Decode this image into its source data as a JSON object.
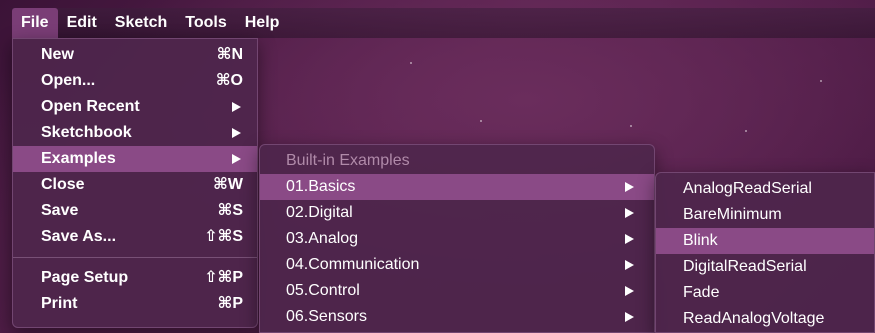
{
  "menubar": {
    "items": [
      {
        "label": "File",
        "active": true
      },
      {
        "label": "Edit"
      },
      {
        "label": "Sketch"
      },
      {
        "label": "Tools"
      },
      {
        "label": "Help"
      }
    ]
  },
  "file_menu": {
    "items": [
      {
        "label": "New",
        "shortcut": "⌘N"
      },
      {
        "label": "Open...",
        "shortcut": "⌘O"
      },
      {
        "label": "Open Recent",
        "submenu": true
      },
      {
        "label": "Sketchbook",
        "submenu": true
      },
      {
        "label": "Examples",
        "submenu": true,
        "highlighted": true
      },
      {
        "label": "Close",
        "shortcut": "⌘W"
      },
      {
        "label": "Save",
        "shortcut": "⌘S"
      },
      {
        "label": "Save As...",
        "shortcut": "⇧⌘S"
      },
      {
        "label": "Page Setup",
        "shortcut": "⇧⌘P"
      },
      {
        "label": "Print",
        "shortcut": "⌘P"
      }
    ]
  },
  "examples_menu": {
    "header": "Built-in Examples",
    "items": [
      {
        "label": "01.Basics",
        "highlighted": true
      },
      {
        "label": "02.Digital"
      },
      {
        "label": "03.Analog"
      },
      {
        "label": "04.Communication"
      },
      {
        "label": "05.Control"
      },
      {
        "label": "06.Sensors"
      }
    ]
  },
  "basics_menu": {
    "items": [
      {
        "label": "AnalogReadSerial"
      },
      {
        "label": "BareMinimum"
      },
      {
        "label": "Blink",
        "highlighted": true
      },
      {
        "label": "DigitalReadSerial"
      },
      {
        "label": "Fade"
      },
      {
        "label": "ReadAnalogVoltage"
      }
    ]
  },
  "colors": {
    "highlight": "#8a4a86",
    "menu_bg": "#4e264c",
    "disabled_text": "#b08aa9"
  }
}
